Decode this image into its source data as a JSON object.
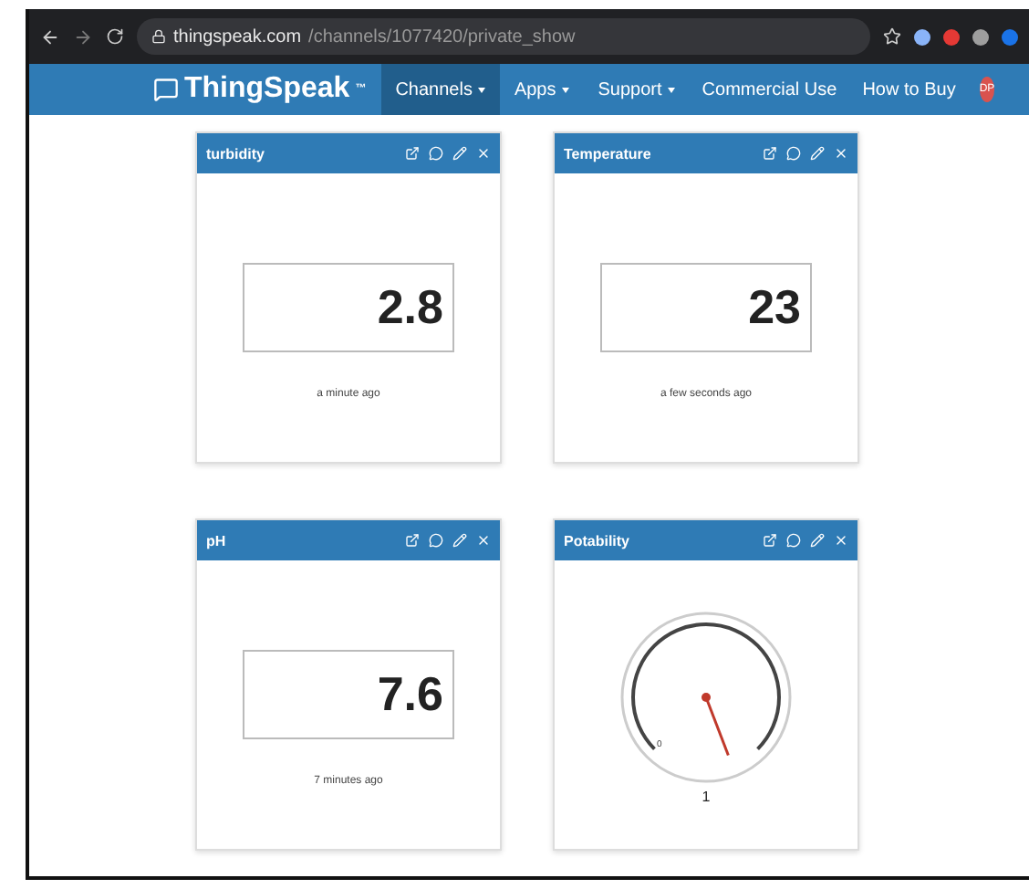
{
  "browser": {
    "url_host": "thingspeak.com",
    "url_path": "/channels/1077420/private_show"
  },
  "nav": {
    "brand": "ThingSpeak",
    "brand_mark": "™",
    "menus": [
      {
        "label": "Channels",
        "selected": true
      },
      {
        "label": "Apps",
        "selected": false
      },
      {
        "label": "Support",
        "selected": false
      }
    ],
    "links": [
      "Commercial Use",
      "How to Buy"
    ],
    "avatar": "DP"
  },
  "widgets": [
    {
      "kind": "numeric",
      "title": "turbidity",
      "value": "2.8",
      "updated": "a minute ago"
    },
    {
      "kind": "numeric",
      "title": "Temperature",
      "value": "23",
      "updated": "a few seconds ago"
    },
    {
      "kind": "numeric",
      "title": "pH",
      "value": "7.6",
      "updated": "7 minutes ago"
    },
    {
      "kind": "gauge",
      "title": "Potability",
      "min_label": "0",
      "value": "1"
    }
  ]
}
